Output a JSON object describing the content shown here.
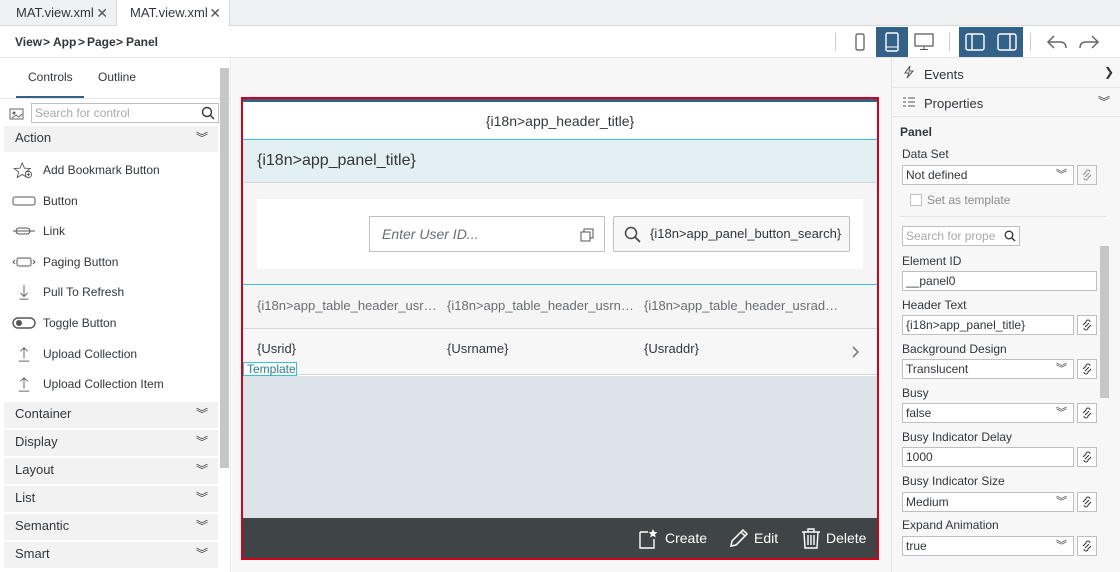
{
  "tabs": [
    {
      "label": "MAT.view.xml",
      "close": "✕"
    },
    {
      "label": "MAT.view.xml",
      "close": "✕"
    }
  ],
  "breadcrumb": {
    "items": [
      "View",
      "App",
      "Page",
      "Panel"
    ],
    "sep": ">"
  },
  "toolbar_icons": [
    "phone-icon",
    "tablet-icon",
    "desktop-icon",
    "left-pane-icon",
    "right-pane-icon",
    "undo-icon",
    "redo-icon"
  ],
  "left": {
    "tabs": [
      "Controls",
      "Outline"
    ],
    "search_placeholder": "Search for control",
    "action_group": "Action",
    "items": [
      "Add Bookmark Button",
      "Button",
      "Link",
      "Paging Button",
      "Pull To Refresh",
      "Toggle Button",
      "Upload Collection",
      "Upload Collection Item"
    ],
    "groups": [
      "Container",
      "Display",
      "Layout",
      "List",
      "Semantic",
      "Smart"
    ]
  },
  "preview": {
    "header_title": "{i18n>app_header_title}",
    "panel_title": "{i18n>app_panel_title}",
    "input_placeholder": "Enter User ID...",
    "search_button": "{i18n>app_panel_button_search}",
    "columns": [
      "{i18n>app_table_header_usr…",
      "{i18n>app_table_header_usrn…",
      "{i18n>app_table_header_usrad…"
    ],
    "row": [
      "{Usrid}",
      "{Usrname}",
      "{Usraddr}"
    ],
    "template_tag": "Template",
    "footer": {
      "create": "Create",
      "edit": "Edit",
      "delete": "Delete"
    }
  },
  "right": {
    "events": "Events",
    "properties": "Properties",
    "section": "Panel",
    "data_set_label": "Data Set",
    "data_set_value": "Not defined",
    "set_as_template": "Set as template",
    "search_placeholder": "Search for prope",
    "props": [
      {
        "label": "Element ID",
        "value": "__panel0"
      },
      {
        "label": "Header Text",
        "value": "{i18n>app_panel_title}"
      },
      {
        "label": "Background Design",
        "value": "Translucent"
      },
      {
        "label": "Busy",
        "value": "false"
      },
      {
        "label": "Busy Indicator Delay",
        "value": "1000"
      },
      {
        "label": "Busy Indicator Size",
        "value": "Medium"
      },
      {
        "label": "Expand Animation",
        "value": "true"
      }
    ]
  },
  "colors": {
    "accent": "#346187",
    "selection": "#d0021b",
    "panel_header": "#e2f0f4",
    "footer": "#3f4447"
  }
}
